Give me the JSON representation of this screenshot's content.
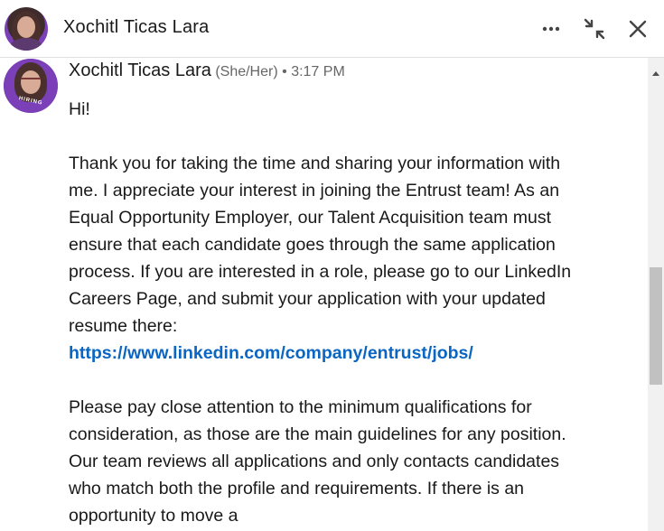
{
  "header": {
    "title": "Xochitl Ticas Lara",
    "more_icon": "more-horizontal-icon",
    "collapse_icon": "collapse-icon",
    "close_icon": "close-icon"
  },
  "message": {
    "sender_name": "Xochitl Ticas Lara",
    "pronoun": "(She/Her)",
    "separator": "•",
    "time": "3:17 PM",
    "avatar_badge": "HIRING",
    "paragraphs": {
      "p1": "Hi!",
      "p2": "Thank you for taking the time and sharing your information with me. I appreciate your interest in joining the Entrust team! As an Equal Opportunity Employer, our Talent Acquisition team must ensure that each candidate goes through the same application process. If you are interested in a role, please go to our LinkedIn Careers Page, and submit your application with your updated resume there:",
      "link": "https://www.linkedin.com/company/entrust/jobs/",
      "p3": "Please pay close attention to the minimum qualifications for consideration, as those are the main guidelines for any position. Our team reviews all applications and only contacts candidates who match both the profile and requirements. If there is an opportunity to move a"
    }
  },
  "colors": {
    "link": "#0a66c2",
    "text": "#191919",
    "muted": "#666666",
    "avatar_ring": "#7b3fb7"
  }
}
